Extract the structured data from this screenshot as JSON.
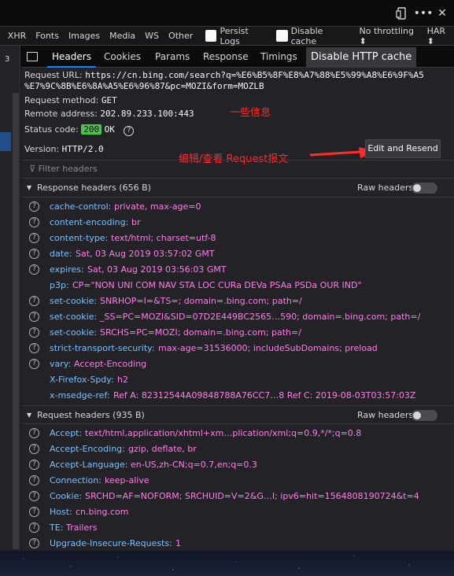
{
  "topbar": {
    "icons": [
      "responsive-mode-icon",
      "more-options-icon",
      "close-icon"
    ]
  },
  "filterbar": {
    "types": [
      "XHR",
      "Fonts",
      "Images",
      "Media",
      "WS",
      "Other"
    ],
    "persist_logs": "Persist Logs",
    "disable_cache": "Disable cache",
    "throttling": "No throttling ⬍",
    "har": "HAR ⬍"
  },
  "leftlist": {
    "row_number": "3"
  },
  "tabs": [
    "Headers",
    "Cookies",
    "Params",
    "Response",
    "Timings"
  ],
  "tooltip": "Disable HTTP cache",
  "summary": {
    "url_label": "Request URL:",
    "url_value_1": "https://cn.bing.com/search?q=%E6%B5%8F%E8%A7%88%E5%99%A8%E6%9F%A5",
    "url_value_2": "%E7%9C%8B%E6%8A%A5%E6%96%87&pc=MOZI&form=MOZLB",
    "method_label": "Request method:",
    "method_value": "GET",
    "remote_label": "Remote address:",
    "remote_value": "202.89.233.100:443",
    "status_label": "Status code:",
    "status_code": "200",
    "status_text": "OK",
    "help": "?",
    "version_label": "Version:",
    "version_value": "HTTP/2.0"
  },
  "edit_resend": "Edit and Resend",
  "annotations": {
    "info": "一些信息",
    "edit": "编辑/查看 Request报文"
  },
  "filter_headers_placeholder": "Filter headers",
  "response_section": {
    "title": "Response headers (656 B)",
    "raw": "Raw headers",
    "headers": [
      {
        "name": "cache-control:",
        "value": "private, max-age=0",
        "help": true
      },
      {
        "name": "content-encoding:",
        "value": "br",
        "help": true
      },
      {
        "name": "content-type:",
        "value": "text/html; charset=utf-8",
        "help": true
      },
      {
        "name": "date:",
        "value": "Sat, 03 Aug 2019 03:57:02 GMT",
        "help": true
      },
      {
        "name": "expires:",
        "value": "Sat, 03 Aug 2019 03:56:03 GMT",
        "help": true
      },
      {
        "name": "p3p:",
        "value": "CP=\"NON UNI COM NAV STA LOC CURa DEVa PSAa PSDa OUR IND\"",
        "help": false
      },
      {
        "name": "set-cookie:",
        "value": "SNRHOP=I=&TS=; domain=.bing.com; path=/",
        "help": true
      },
      {
        "name": "set-cookie:",
        "value": "_SS=PC=MOZI&SID=07D2E449BC2565…590; domain=.bing.com; path=/",
        "help": true
      },
      {
        "name": "set-cookie:",
        "value": "SRCHS=PC=MOZI; domain=.bing.com; path=/",
        "help": true
      },
      {
        "name": "strict-transport-security:",
        "value": "max-age=31536000; includeSubDomains; preload",
        "help": true
      },
      {
        "name": "vary:",
        "value": "Accept-Encoding",
        "help": true
      },
      {
        "name": "X-Firefox-Spdy:",
        "value": "h2",
        "help": false
      },
      {
        "name": "x-msedge-ref:",
        "value": "Ref A: 82312544A09848788A76CC7…8 Ref C: 2019-08-03T03:57:03Z",
        "help": false
      }
    ]
  },
  "request_section": {
    "title": "Request headers (935 B)",
    "raw": "Raw headers",
    "headers": [
      {
        "name": "Accept:",
        "value": "text/html,application/xhtml+xm…plication/xml;q=0.9,*/*;q=0.8",
        "help": true
      },
      {
        "name": "Accept-Encoding:",
        "value": "gzip, deflate, br",
        "help": true
      },
      {
        "name": "Accept-Language:",
        "value": "en-US,zh-CN;q=0.7,en;q=0.3",
        "help": true
      },
      {
        "name": "Connection:",
        "value": "keep-alive",
        "help": true
      },
      {
        "name": "Cookie:",
        "value": "SRCHD=AF=NOFORM; SRCHUID=V=2&G…I; ipv6=hit=1564808190724&t=4",
        "help": true
      },
      {
        "name": "Host:",
        "value": "cn.bing.com",
        "help": true
      },
      {
        "name": "TE:",
        "value": "Trailers",
        "help": true
      },
      {
        "name": "Upgrade-Insecure-Requests:",
        "value": "1",
        "help": true
      }
    ]
  }
}
